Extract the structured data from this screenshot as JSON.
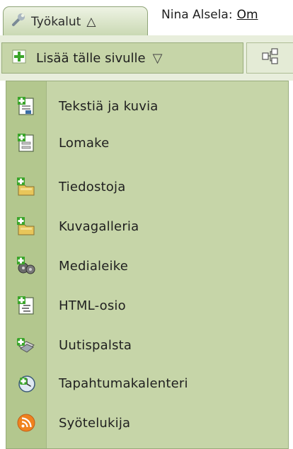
{
  "topbar": {
    "tools_label": "Työkalut",
    "tools_caret": "△",
    "user_text": "Nina Alsela:",
    "user_link": "Om"
  },
  "toolbar": {
    "add_label": "Lisää tälle sivulle",
    "add_caret": "▽"
  },
  "menu": {
    "items": [
      {
        "label": "Tekstiä ja kuvia",
        "icon": "text-and-images-icon"
      },
      {
        "label": "Lomake",
        "icon": "form-icon"
      },
      {
        "label": "Tiedostoja",
        "icon": "files-icon"
      },
      {
        "label": "Kuvagalleria",
        "icon": "image-gallery-icon"
      },
      {
        "label": "Medialeike",
        "icon": "media-clip-icon"
      },
      {
        "label": "HTML-osio",
        "icon": "html-section-icon"
      },
      {
        "label": "Uutispalsta",
        "icon": "news-column-icon"
      },
      {
        "label": "Tapahtumakalenteri",
        "icon": "event-calendar-icon"
      },
      {
        "label": "Syötelukija",
        "icon": "feed-reader-icon"
      }
    ]
  },
  "colors": {
    "menu_bg": "#c6d5a8",
    "icon_strip": "#b3c78e",
    "border": "#98ac7c",
    "add_green": "#3aa52a",
    "rss_orange": "#f0821e"
  }
}
